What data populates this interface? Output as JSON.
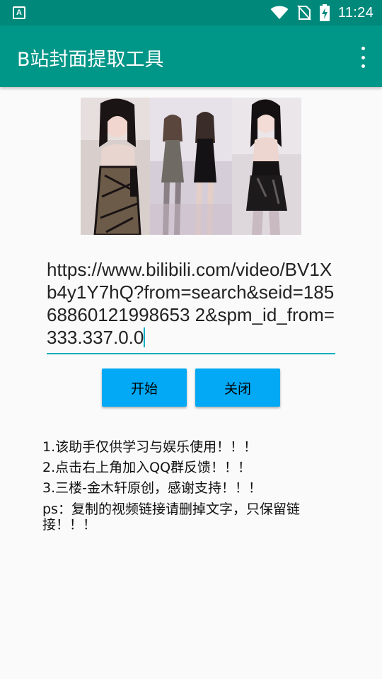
{
  "status_bar": {
    "notification_glyph": "A",
    "time": "11:24",
    "icons": [
      "wifi-icon",
      "no-sim-icon",
      "battery-charging-icon"
    ]
  },
  "app_bar": {
    "title": "B站封面提取工具",
    "overflow_icon": "more-vert-icon"
  },
  "cover_image": {
    "description_icon": "video-cover-image"
  },
  "url_input": {
    "value": "https://www.bilibili.com/video/BV1Xb4y1Y7hQ?from=search&seid=18568860121998653 2&spm_id_from=333.337.0.0"
  },
  "buttons": {
    "start_label": "开始",
    "close_label": "关闭"
  },
  "notes": {
    "line1": "1.该助手仅供学习与娱乐使用！！！",
    "line2": "2.点击右上角加入QQ群反馈！！！",
    "line3": "3.三楼-金木轩原创，感谢支持！！！",
    "line4": "ps：复制的视频链接请删掉文字，只保留链接！！！"
  },
  "colors": {
    "status_bar": "#00897b",
    "app_bar": "#009688",
    "button": "#03a9f4",
    "accent": "#00acc1",
    "background": "#fafafa"
  }
}
